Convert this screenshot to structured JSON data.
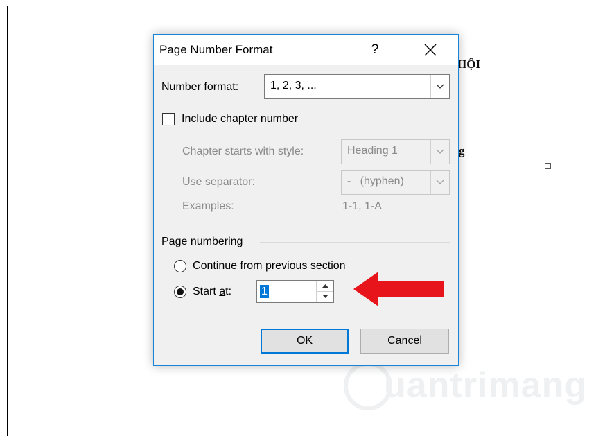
{
  "document": {
    "fragment_1": "HỘI",
    "fragment_2": "g"
  },
  "dialog": {
    "title": "Page Number Format",
    "help_glyph": "?",
    "number_format": {
      "label_pre": "Number ",
      "label_u": "f",
      "label_post": "ormat:",
      "value": "1, 2, 3, ..."
    },
    "include_chapter": {
      "label_pre": "Include chapter ",
      "label_u": "n",
      "label_post": "umber",
      "checked": false
    },
    "chapter_style": {
      "label": "Chapter starts with style:",
      "value": "Heading 1"
    },
    "separator": {
      "label": "Use separator:",
      "value": "-   (hyphen)"
    },
    "examples": {
      "label": "Examples:",
      "value": "1-1, 1-A"
    },
    "page_numbering": {
      "group_label": "Page numbering",
      "continue_u": "C",
      "continue_post": "ontinue from previous section",
      "start_pre": "Start ",
      "start_u": "a",
      "start_post": "t:",
      "start_value": "1",
      "selected": "start_at"
    },
    "ok_label": "OK",
    "cancel_label": "Cancel"
  },
  "watermark": {
    "text": "uantrimang"
  },
  "colors": {
    "accent": "#0078d7",
    "border": "#1883d7",
    "arrow": "#e8141b"
  }
}
